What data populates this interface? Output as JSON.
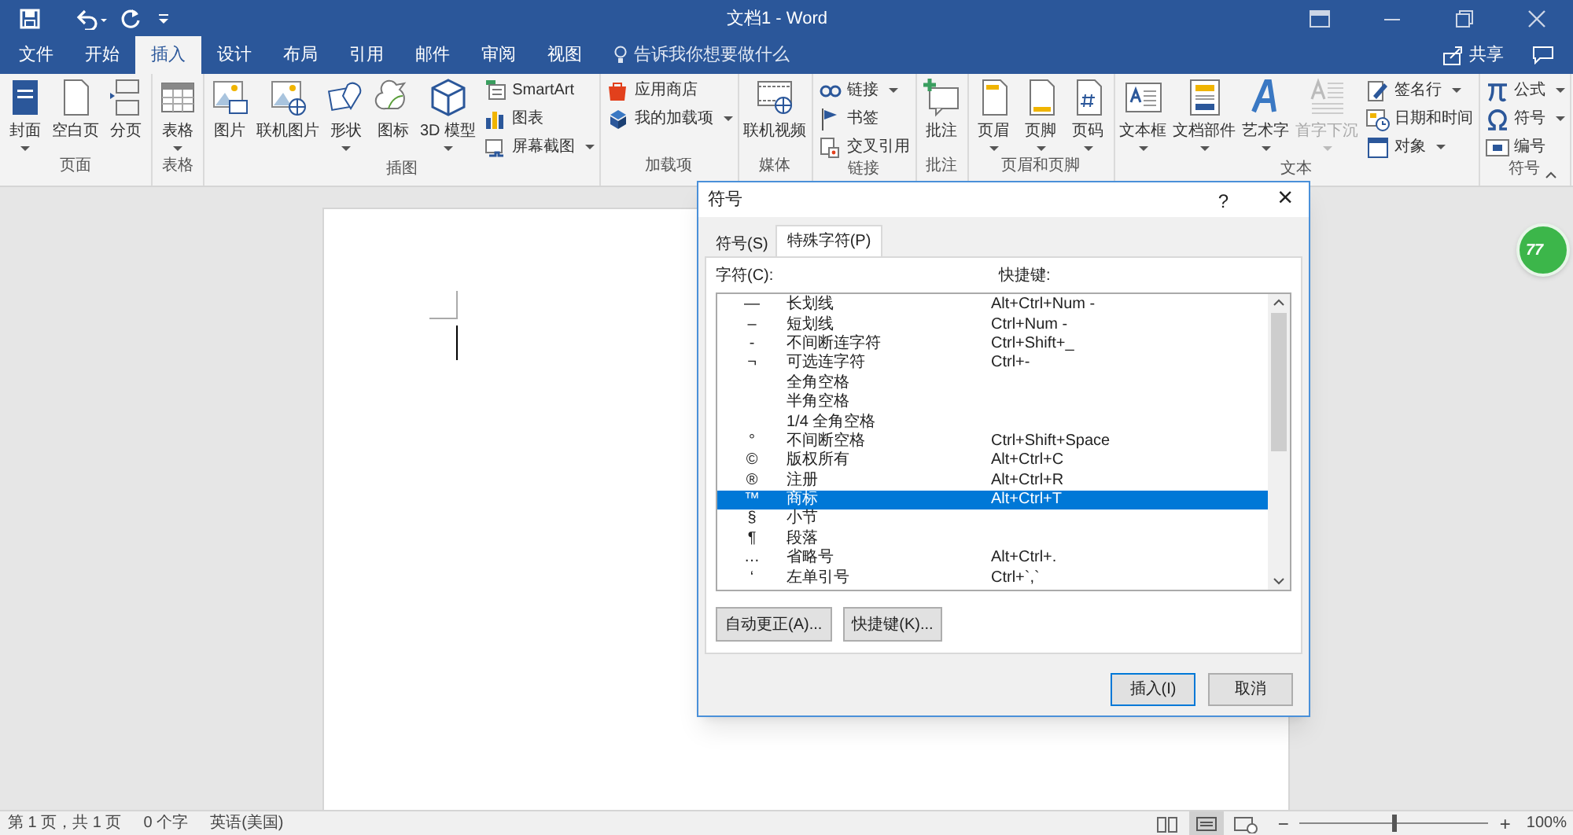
{
  "window": {
    "title": "文档1 - Word",
    "share": "共享"
  },
  "tabs": [
    {
      "label": "文件",
      "selected": false
    },
    {
      "label": "开始",
      "selected": false
    },
    {
      "label": "插入",
      "selected": true
    },
    {
      "label": "设计",
      "selected": false
    },
    {
      "label": "布局",
      "selected": false
    },
    {
      "label": "引用",
      "selected": false
    },
    {
      "label": "邮件",
      "selected": false
    },
    {
      "label": "审阅",
      "selected": false
    },
    {
      "label": "视图",
      "selected": false
    }
  ],
  "tell_me": {
    "placeholder": "告诉我你想要做什么"
  },
  "ribbon_groups": [
    {
      "label": "页面",
      "items": [
        {
          "kind": "large",
          "label": "封面",
          "dropdown": true
        },
        {
          "kind": "large",
          "label": "空白页",
          "dropdown": false
        },
        {
          "kind": "large",
          "label": "分页",
          "dropdown": false
        }
      ]
    },
    {
      "label": "表格",
      "items": [
        {
          "kind": "large",
          "label": "表格",
          "dropdown": true
        }
      ]
    },
    {
      "label": "插图",
      "items": [
        {
          "kind": "large",
          "label": "图片",
          "dropdown": false
        },
        {
          "kind": "large",
          "label": "联机图片",
          "dropdown": false
        },
        {
          "kind": "large",
          "label": "形状",
          "dropdown": true
        },
        {
          "kind": "large",
          "label": "图标",
          "dropdown": false
        },
        {
          "kind": "large",
          "label": "3D 模型",
          "dropdown": true
        },
        {
          "kind": "small",
          "label": "SmartArt",
          "dropdown": false
        },
        {
          "kind": "small",
          "label": "图表",
          "dropdown": false
        },
        {
          "kind": "small",
          "label": "屏幕截图",
          "dropdown": true
        }
      ]
    },
    {
      "label": "加载项",
      "items": [
        {
          "kind": "small",
          "label": "应用商店",
          "dropdown": false
        },
        {
          "kind": "small",
          "label": "我的加载项",
          "dropdown": true
        }
      ]
    },
    {
      "label": "媒体",
      "items": [
        {
          "kind": "large",
          "label": "联机视频",
          "dropdown": false
        }
      ]
    },
    {
      "label": "链接",
      "items": [
        {
          "kind": "small",
          "label": "链接",
          "dropdown": true
        },
        {
          "kind": "small",
          "label": "书签",
          "dropdown": false
        },
        {
          "kind": "small",
          "label": "交叉引用",
          "dropdown": false
        }
      ]
    },
    {
      "label": "批注",
      "items": [
        {
          "kind": "large",
          "label": "批注",
          "dropdown": false
        }
      ]
    },
    {
      "label": "页眉和页脚",
      "items": [
        {
          "kind": "large",
          "label": "页眉",
          "dropdown": true
        },
        {
          "kind": "large",
          "label": "页脚",
          "dropdown": true
        },
        {
          "kind": "large",
          "label": "页码",
          "dropdown": true
        }
      ]
    },
    {
      "label": "文本",
      "items": [
        {
          "kind": "large",
          "label": "文本框",
          "dropdown": true
        },
        {
          "kind": "large",
          "label": "文档部件",
          "dropdown": true
        },
        {
          "kind": "large",
          "label": "艺术字",
          "dropdown": true
        },
        {
          "kind": "large",
          "label": "首字下沉",
          "dropdown": true,
          "disabled": true
        },
        {
          "kind": "small",
          "label": "签名行",
          "dropdown": true
        },
        {
          "kind": "small",
          "label": "日期和时间",
          "dropdown": false
        },
        {
          "kind": "small",
          "label": "对象",
          "dropdown": true
        }
      ]
    },
    {
      "label": "符号",
      "items": [
        {
          "kind": "small",
          "label": "公式",
          "dropdown": true
        },
        {
          "kind": "small",
          "label": "符号",
          "dropdown": true
        },
        {
          "kind": "small",
          "label": "编号",
          "dropdown": false
        }
      ]
    }
  ],
  "badge": "77",
  "dialog": {
    "title": "符号",
    "help": "?",
    "close": "×",
    "tabs": [
      {
        "label": "符号(S)",
        "selected": false
      },
      {
        "label": "特殊字符(P)",
        "selected": true
      }
    ],
    "column_1": "字符(C):",
    "column_2": "快捷键:",
    "rows": [
      {
        "symbol": "—",
        "name": "长划线",
        "shortcut": "Alt+Ctrl+Num -",
        "selected": false
      },
      {
        "symbol": "–",
        "name": "短划线",
        "shortcut": "Ctrl+Num -",
        "selected": false
      },
      {
        "symbol": "‑",
        "name": "不间断连字符",
        "shortcut": "Ctrl+Shift+_",
        "selected": false
      },
      {
        "symbol": "¬",
        "name": "可选连字符",
        "shortcut": "Ctrl+-",
        "selected": false
      },
      {
        "name": "全角空格",
        "selected": false
      },
      {
        "name": "半角空格",
        "selected": false
      },
      {
        "name": "1/4 全角空格",
        "selected": false
      },
      {
        "symbol": "°",
        "name": "不间断空格",
        "shortcut": "Ctrl+Shift+Space",
        "selected": false
      },
      {
        "symbol": "©",
        "name": "版权所有",
        "shortcut": "Alt+Ctrl+C",
        "selected": false
      },
      {
        "symbol": "®",
        "name": "注册",
        "shortcut": "Alt+Ctrl+R",
        "selected": false
      },
      {
        "symbol": "™",
        "name": "商标",
        "shortcut": "Alt+Ctrl+T",
        "selected": true
      },
      {
        "symbol": "§",
        "name": "小节",
        "selected": false
      },
      {
        "symbol": "¶",
        "name": "段落",
        "selected": false
      },
      {
        "symbol": "…",
        "name": "省略号",
        "shortcut": "Alt+Ctrl+.",
        "selected": false
      },
      {
        "symbol": "‘",
        "name": "左单引号",
        "shortcut": "Ctrl+`,`",
        "selected": false
      }
    ],
    "buttons": [
      "自动更正(A)...",
      "快捷键(K)..."
    ],
    "insert": "插入(I)",
    "cancel": "取消"
  },
  "status_bar": {
    "page": "第 1 页，共 1 页",
    "words": "0 个字",
    "language": "英语(美国)",
    "zoom_out": "−",
    "zoom": {
      "level": 0.5
    },
    "zoom_in": "+",
    "zoom_reading": "100%"
  }
}
